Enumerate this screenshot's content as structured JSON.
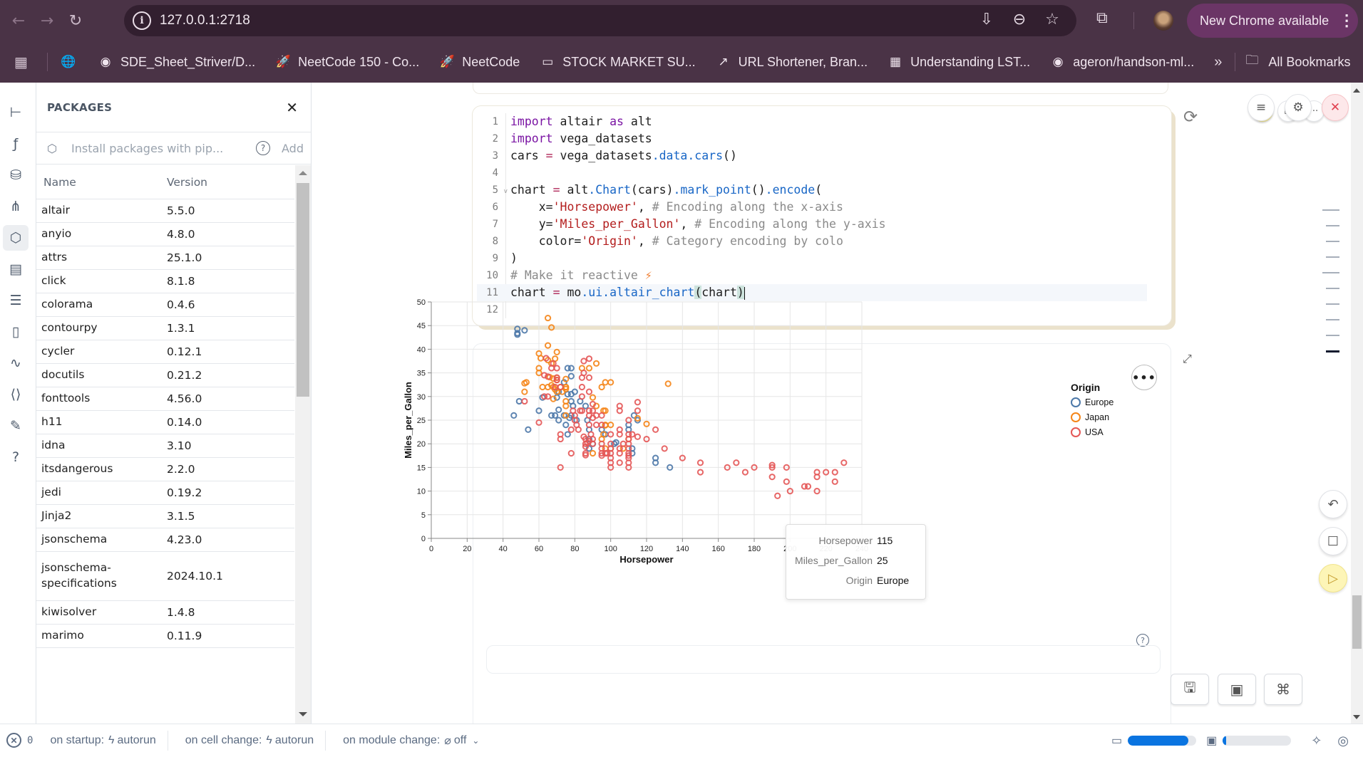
{
  "browser": {
    "url": "127.0.0.1:2718",
    "update_label": "New Chrome available",
    "bookmarks": [
      {
        "label": "SDE_Sheet_Striver/D...",
        "icon": "github-icon"
      },
      {
        "label": "NeetCode 150 - Co...",
        "icon": "rocket-icon"
      },
      {
        "label": "NeetCode",
        "icon": "rocket-icon"
      },
      {
        "label": "STOCK MARKET SU...",
        "icon": "page-icon"
      },
      {
        "label": "URL Shortener, Bran...",
        "icon": "link-icon"
      },
      {
        "label": "Understanding LST...",
        "icon": "image-icon"
      },
      {
        "label": "ageron/handson-ml...",
        "icon": "github-icon"
      }
    ],
    "more_label": "»",
    "all_bookmarks_label": "All Bookmarks"
  },
  "packages": {
    "title": "PACKAGES",
    "install_placeholder": "Install packages with pip...",
    "add_label": "Add",
    "columns": [
      "Name",
      "Version"
    ],
    "rows": [
      {
        "name": "altair",
        "version": "5.5.0"
      },
      {
        "name": "anyio",
        "version": "4.8.0"
      },
      {
        "name": "attrs",
        "version": "25.1.0"
      },
      {
        "name": "click",
        "version": "8.1.8"
      },
      {
        "name": "colorama",
        "version": "0.4.6"
      },
      {
        "name": "contourpy",
        "version": "1.3.1"
      },
      {
        "name": "cycler",
        "version": "0.12.1"
      },
      {
        "name": "docutils",
        "version": "0.21.2"
      },
      {
        "name": "fonttools",
        "version": "4.56.0"
      },
      {
        "name": "h11",
        "version": "0.14.0"
      },
      {
        "name": "idna",
        "version": "3.10"
      },
      {
        "name": "itsdangerous",
        "version": "2.2.0"
      },
      {
        "name": "jedi",
        "version": "0.19.2"
      },
      {
        "name": "Jinja2",
        "version": "3.1.5"
      },
      {
        "name": "jsonschema",
        "version": "4.23.0"
      },
      {
        "name": "jsonschema-specifications",
        "version": "2024.10.1"
      },
      {
        "name": "kiwisolver",
        "version": "1.4.8"
      },
      {
        "name": "marimo",
        "version": "0.11.9"
      }
    ]
  },
  "code": {
    "lines": [
      "import altair as alt",
      "import vega_datasets",
      "cars = vega_datasets.data.cars()",
      "",
      "chart = alt.Chart(cars).mark_point().encode(",
      "    x='Horsepower', # Encoding along the x-axis",
      "    y='Miles_per_Gallon', # Encoding along the y-axis",
      "    color='Origin', # Category encoding by colo",
      ")",
      "# Make it reactive ⚡",
      "chart = mo.ui.altair_chart(chart)",
      ""
    ],
    "active_line": 11
  },
  "tooltip": {
    "rows": [
      {
        "key": "Horsepower",
        "value": "115"
      },
      {
        "key": "Miles_per_Gallon",
        "value": "25"
      },
      {
        "key": "Origin",
        "value": "Europe"
      }
    ]
  },
  "footer": {
    "error_count": "0",
    "startup_label": "on startup:",
    "startup_value": "autorun",
    "cell_change_label": "on cell change:",
    "cell_change_value": "autorun",
    "module_change_label": "on module change:",
    "module_change_value": "off",
    "memory_usage": 0.88,
    "cpu_usage": 0.05
  },
  "colors": {
    "Europe": "#4c78a8",
    "Japan": "#f58518",
    "USA": "#e45756"
  },
  "chart_data": {
    "type": "scatter",
    "title": "",
    "xlabel": "Horsepower",
    "ylabel": "Miles_per_Gallon",
    "xlim": [
      0,
      240
    ],
    "ylim": [
      0,
      50
    ],
    "xticks": [
      0,
      20,
      40,
      60,
      80,
      100,
      120,
      140,
      160,
      180,
      200,
      220,
      240
    ],
    "yticks": [
      0,
      5,
      10,
      15,
      20,
      25,
      30,
      35,
      40,
      45,
      50
    ],
    "grid": true,
    "legend": {
      "title": "Origin",
      "position": "right",
      "entries": [
        "Europe",
        "Japan",
        "USA"
      ]
    },
    "series": [
      {
        "name": "Europe",
        "points": [
          [
            48,
            44.3
          ],
          [
            48,
            43.1
          ],
          [
            48,
            43.4
          ],
          [
            52,
            44
          ],
          [
            46,
            26
          ],
          [
            49,
            29
          ],
          [
            54,
            23
          ],
          [
            60,
            27
          ],
          [
            62,
            29.8
          ],
          [
            67,
            26
          ],
          [
            69,
            26
          ],
          [
            70,
            29.8
          ],
          [
            71,
            31
          ],
          [
            71,
            25
          ],
          [
            71,
            27.2
          ],
          [
            74,
            33
          ],
          [
            76,
            36
          ],
          [
            75,
            24
          ],
          [
            76,
            22
          ],
          [
            76,
            30.5
          ],
          [
            78,
            30.5
          ],
          [
            77,
            25.5
          ],
          [
            78,
            29
          ],
          [
            78,
            34.3
          ],
          [
            78,
            26
          ],
          [
            79,
            28
          ],
          [
            80,
            31
          ],
          [
            81,
            25
          ],
          [
            83,
            29
          ],
          [
            86,
            28
          ],
          [
            87,
            25
          ],
          [
            88,
            23
          ],
          [
            88,
            19
          ],
          [
            88,
            21
          ],
          [
            90,
            20
          ],
          [
            95,
            23
          ],
          [
            97,
            22
          ],
          [
            102,
            20
          ],
          [
            103,
            20.3
          ],
          [
            110,
            24
          ],
          [
            110,
            23
          ],
          [
            112,
            19
          ],
          [
            112,
            18
          ],
          [
            113,
            26
          ],
          [
            115,
            25
          ],
          [
            125,
            17
          ],
          [
            125,
            16
          ],
          [
            133,
            15
          ],
          [
            74,
            26
          ],
          [
            78,
            36
          ]
        ]
      },
      {
        "name": "Japan",
        "points": [
          [
            65,
            46.6
          ],
          [
            67,
            44.6
          ],
          [
            65,
            40.8
          ],
          [
            70,
            39.4
          ],
          [
            60,
            39.1
          ],
          [
            61,
            38.1
          ],
          [
            65,
            37.7
          ],
          [
            67,
            37
          ],
          [
            69,
            38
          ],
          [
            60,
            36
          ],
          [
            60,
            35
          ],
          [
            66,
            34.1
          ],
          [
            68,
            33.8
          ],
          [
            52,
            32.8
          ],
          [
            53,
            33
          ],
          [
            52,
            31
          ],
          [
            62,
            32
          ],
          [
            65,
            32
          ],
          [
            67,
            32.4
          ],
          [
            68,
            32
          ],
          [
            69,
            31.5
          ],
          [
            70,
            34
          ],
          [
            70,
            33.5
          ],
          [
            72,
            32
          ],
          [
            75,
            33.7
          ],
          [
            75,
            32
          ],
          [
            75,
            31.6
          ],
          [
            75,
            29
          ],
          [
            75,
            28
          ],
          [
            75,
            26
          ],
          [
            84,
            36
          ],
          [
            88,
            36
          ],
          [
            92,
            37
          ],
          [
            97,
            33
          ],
          [
            100,
            33
          ],
          [
            95,
            32
          ],
          [
            90,
            29.8
          ],
          [
            92,
            28
          ],
          [
            96,
            27
          ],
          [
            97,
            27
          ],
          [
            97,
            24
          ],
          [
            100,
            24
          ],
          [
            96,
            22
          ],
          [
            95,
            21
          ],
          [
            90,
            18
          ],
          [
            97,
            19
          ],
          [
            100,
            19
          ],
          [
            107,
            19
          ],
          [
            110,
            21
          ],
          [
            115,
            25.4
          ],
          [
            120,
            24.2
          ],
          [
            132,
            32.7
          ],
          [
            97,
            23.9
          ],
          [
            75,
            32
          ],
          [
            73,
            31
          ],
          [
            70,
            31
          ],
          [
            68,
            29.5
          ]
        ]
      },
      {
        "name": "USA",
        "points": [
          [
            64,
            38.1
          ],
          [
            68,
            37
          ],
          [
            63,
            34.5
          ],
          [
            65,
            34.2
          ],
          [
            67,
            36
          ],
          [
            70,
            34
          ],
          [
            70,
            36
          ],
          [
            70,
            33.5
          ],
          [
            63,
            30
          ],
          [
            65,
            30
          ],
          [
            69,
            32
          ],
          [
            72,
            32
          ],
          [
            60,
            24.5
          ],
          [
            52,
            29
          ],
          [
            72,
            22
          ],
          [
            72,
            21
          ],
          [
            72,
            15
          ],
          [
            78,
            18
          ],
          [
            78,
            23
          ],
          [
            79,
            27
          ],
          [
            80,
            25
          ],
          [
            80,
            26
          ],
          [
            81,
            24
          ],
          [
            82,
            23
          ],
          [
            83,
            27
          ],
          [
            84,
            27
          ],
          [
            84,
            32
          ],
          [
            84,
            30
          ],
          [
            84,
            34
          ],
          [
            85,
            35
          ],
          [
            85,
            37.5
          ],
          [
            88,
            38
          ],
          [
            88,
            34
          ],
          [
            88,
            31
          ],
          [
            88,
            27
          ],
          [
            88,
            26
          ],
          [
            88,
            24
          ],
          [
            89,
            22
          ],
          [
            90,
            21
          ],
          [
            90,
            20
          ],
          [
            90,
            25.5
          ],
          [
            90,
            28.4
          ],
          [
            90,
            27
          ],
          [
            92,
            26
          ],
          [
            92,
            24
          ],
          [
            95,
            26
          ],
          [
            95,
            24
          ],
          [
            95,
            20
          ],
          [
            95,
            19
          ],
          [
            95,
            18
          ],
          [
            95,
            17.5
          ],
          [
            97,
            18
          ],
          [
            98,
            18
          ],
          [
            100,
            22
          ],
          [
            100,
            20
          ],
          [
            100,
            19
          ],
          [
            100,
            18
          ],
          [
            100,
            17
          ],
          [
            100,
            16
          ],
          [
            100,
            15
          ],
          [
            105,
            28
          ],
          [
            105,
            27
          ],
          [
            105,
            23
          ],
          [
            105,
            22
          ],
          [
            105,
            19
          ],
          [
            105,
            18
          ],
          [
            105,
            16
          ],
          [
            107,
            20
          ],
          [
            110,
            25
          ],
          [
            110,
            22
          ],
          [
            110,
            21
          ],
          [
            110,
            20
          ],
          [
            110,
            19
          ],
          [
            110,
            18
          ],
          [
            110,
            17.5
          ],
          [
            110,
            17
          ],
          [
            110,
            16
          ],
          [
            110,
            15
          ],
          [
            112,
            22
          ],
          [
            115,
            28.8
          ],
          [
            115,
            27
          ],
          [
            115,
            21.5
          ],
          [
            120,
            21
          ],
          [
            125,
            23
          ],
          [
            130,
            19
          ],
          [
            140,
            17
          ],
          [
            150,
            14
          ],
          [
            150,
            16
          ],
          [
            165,
            15
          ],
          [
            170,
            16
          ],
          [
            175,
            14
          ],
          [
            180,
            15
          ],
          [
            190,
            15.5
          ],
          [
            190,
            15
          ],
          [
            190,
            13
          ],
          [
            193,
            9
          ],
          [
            198,
            15
          ],
          [
            198,
            12
          ],
          [
            200,
            10
          ],
          [
            208,
            11
          ],
          [
            210,
            11
          ],
          [
            215,
            14
          ],
          [
            215,
            13
          ],
          [
            215,
            10
          ],
          [
            220,
            14
          ],
          [
            225,
            14
          ],
          [
            225,
            12
          ],
          [
            230,
            16
          ],
          [
            86,
            19.4
          ],
          [
            86,
            20
          ],
          [
            86,
            21
          ],
          [
            86,
            18
          ],
          [
            86,
            17.6
          ],
          [
            87,
            20.2
          ],
          [
            88,
            20.6
          ],
          [
            85,
            21.5
          ]
        ]
      }
    ]
  }
}
